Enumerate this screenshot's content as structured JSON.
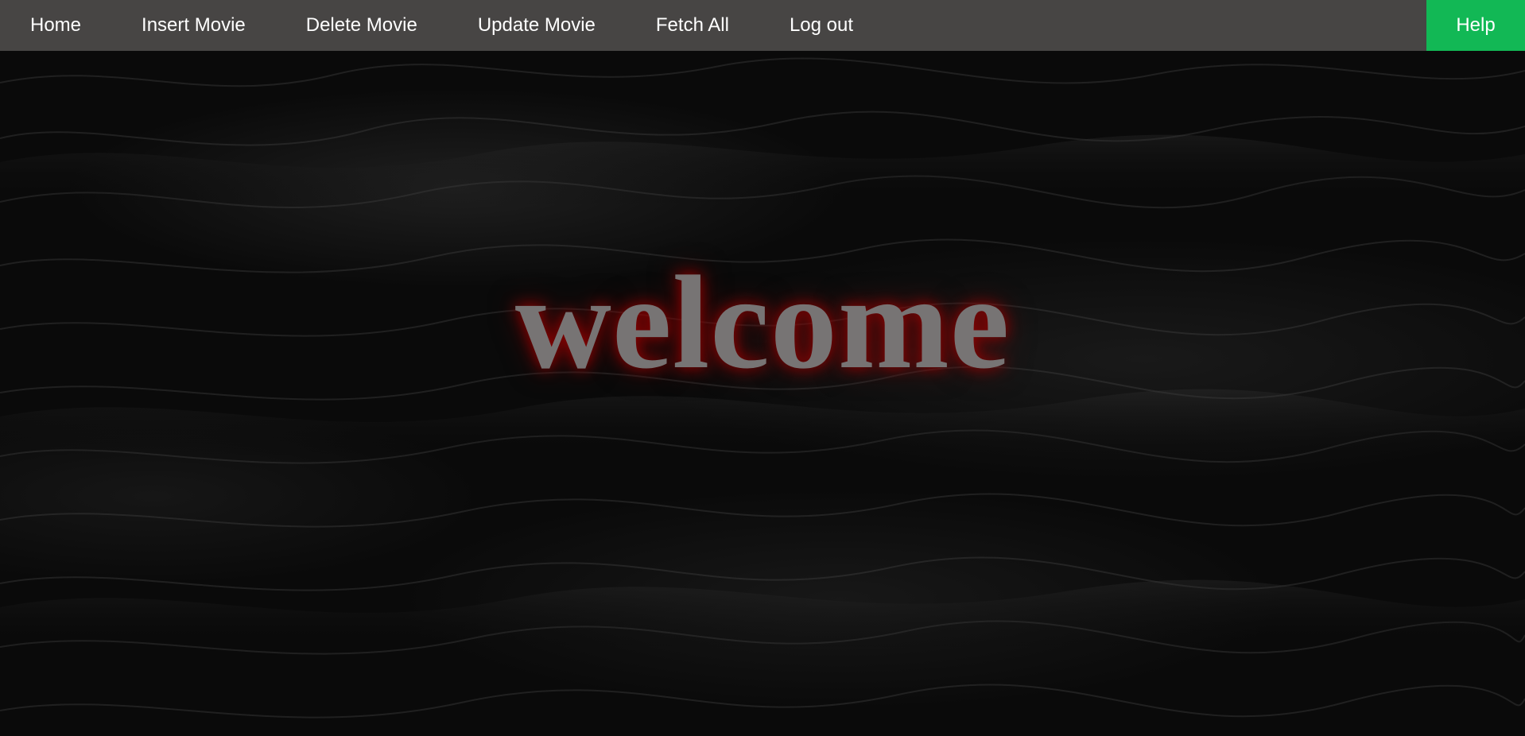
{
  "nav": {
    "items": [
      {
        "label": "Home"
      },
      {
        "label": "Insert Movie"
      },
      {
        "label": "Delete Movie"
      },
      {
        "label": "Update Movie"
      },
      {
        "label": "Fetch All"
      },
      {
        "label": "Log out"
      }
    ],
    "help_label": "Help"
  },
  "hero": {
    "heading": "welcome"
  },
  "colors": {
    "navbar": "#474544",
    "help_button": "#12b855",
    "heading_text": "#777474",
    "heading_glow": "#a00000",
    "background": "#0a0a0a"
  }
}
